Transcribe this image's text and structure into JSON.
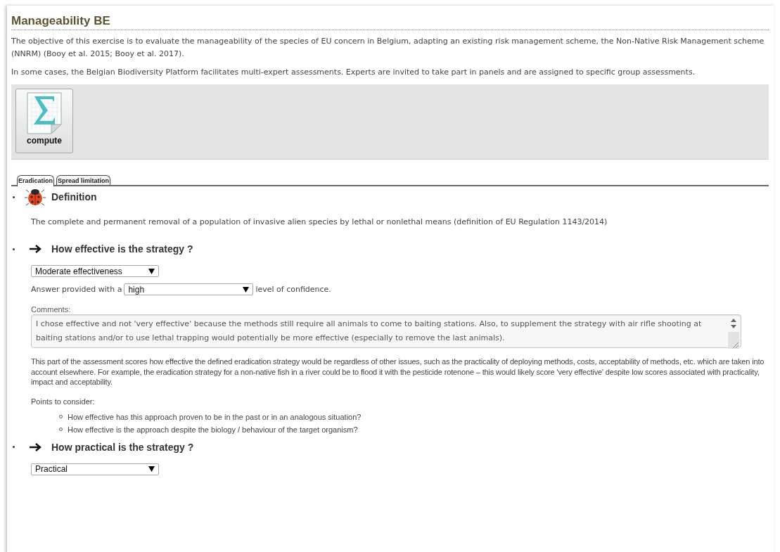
{
  "title": "Manageability BE",
  "intro": [
    "The objective of this exercise is to evaluate the manageability of the species of EU concern in Belgium, adapting an existing risk management scheme, the Non-Native Risk Management scheme (NNRM) (Booy et al. 2015; Booy et al. 2017).",
    "In some cases, the Belgian Biodiversity Platform facilitates multi-expert assessments. Experts are invited to take part in panels and are assigned to specific group assessments."
  ],
  "toolbar": {
    "buttons": [
      {
        "label": "compute"
      }
    ]
  },
  "tabs": [
    {
      "label": "Eradication",
      "selected": true
    },
    {
      "label": "Spread limitation",
      "selected": false
    }
  ],
  "sections": [
    {
      "kind": "definition",
      "heading": "Definition",
      "text": "The complete and permanent removal of a population of invasive alien species by lethal or nonlethal means (definition of EU Regulation 1143/2014)"
    },
    {
      "kind": "question",
      "heading": "How effective is the strategy ?",
      "answer": "Moderate effectiveness",
      "confidence_prefix": "Answer provided with a",
      "confidence": "high",
      "confidence_suffix": "level of confidence.",
      "comments_label": "Comments:",
      "comments": "I chose effective and not 'very effective' because the methods still require all animals to come to baiting stations. Also, to supplement the strategy with air rifle shooting at baiting stations and/or to use lethal trapping would potentially be more effective (especially to remove the last animals).",
      "description": "This part of the assessment scores how effective the defined eradication strategy would be regardless of other issues, such as the practicality of deploying methods, costs, acceptability of methods, etc. which are taken into account elsewhere.  For example, the eradication strategy for a non-native fish in a river could be to flood it with the pesticide rotenone – this would likely score 'very effective' despite low scores associated with practicality, impact and acceptability.",
      "points_label": "Points to consider:",
      "points": [
        "How effective has this approach proven to be in the past or in an analogous situation?",
        "How effective is the approach despite the biology / behaviour of the target organism?"
      ]
    },
    {
      "kind": "question",
      "heading": "How practical is the strategy ?",
      "answer": "Practical"
    }
  ]
}
